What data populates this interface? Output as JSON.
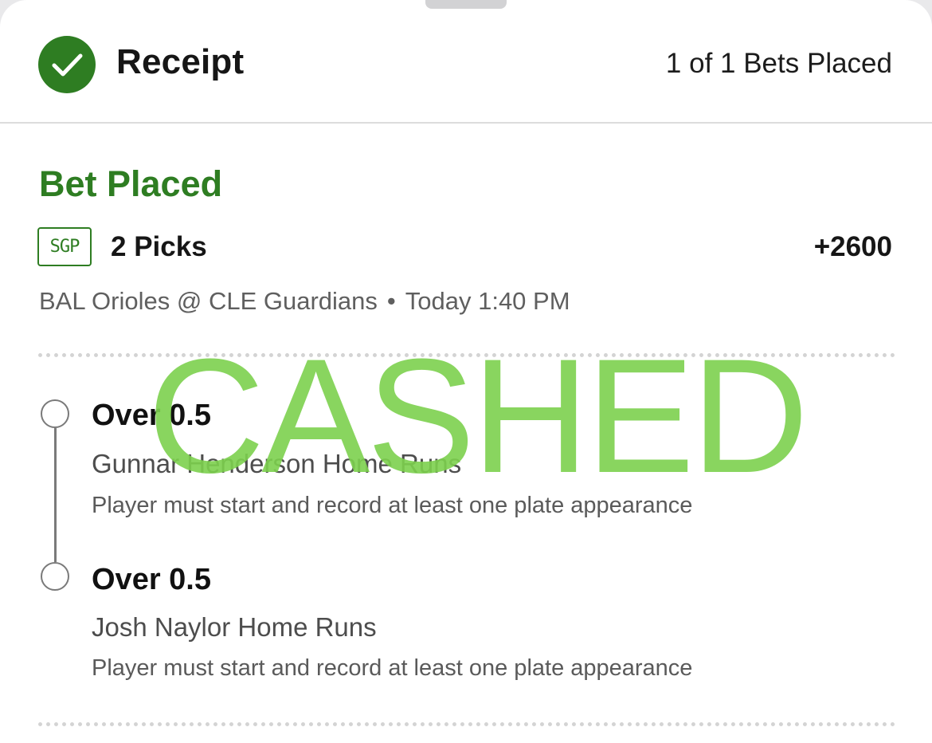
{
  "header": {
    "title": "Receipt",
    "bets_placed": "1 of 1 Bets Placed"
  },
  "bet": {
    "status": "Bet Placed",
    "badge": "SGP",
    "picks": "2 Picks",
    "odds": "+2600",
    "matchup": "BAL Orioles @ CLE Guardians",
    "separator": "•",
    "time": "Today 1:40 PM"
  },
  "legs": [
    {
      "line": "Over 0.5",
      "market": "Gunnar Henderson Home Runs",
      "note": "Player must start and record at least one plate appearance"
    },
    {
      "line": "Over 0.5",
      "market": "Josh Naylor Home Runs",
      "note": "Player must start and record at least one plate appearance"
    }
  ],
  "stamp": "CASHED",
  "colors": {
    "accent_green": "#2e7d22",
    "stamp_green": "#7dd14e"
  },
  "icons": {
    "status": "checkmark-circle-icon",
    "leg_marker": "hollow-circle-icon"
  }
}
